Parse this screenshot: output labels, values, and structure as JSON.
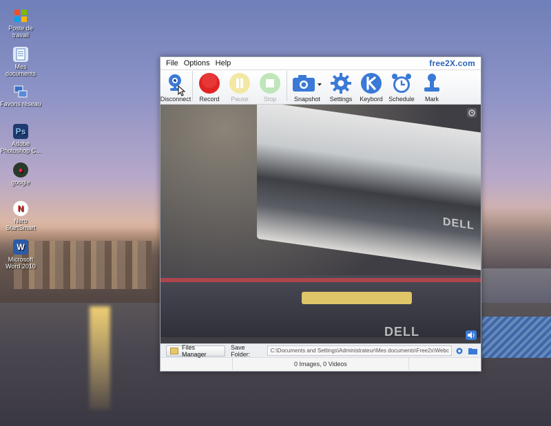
{
  "desktop": {
    "icons": [
      {
        "label": "Poste de travail",
        "glyph": "windows-logo",
        "color": "#2f8fe0"
      },
      {
        "label": "Mes documents",
        "glyph": "folder-doc",
        "color": "#6aa0d8"
      },
      {
        "label": "Favoris réseau",
        "glyph": "network",
        "color": "#3b6fc2"
      },
      {
        "label": "Adobe Photoshop C...",
        "glyph": "Ps",
        "color": "#1e3a6e"
      },
      {
        "label": "google",
        "glyph": "g",
        "color": "#2a6b2a"
      },
      {
        "label": "Nero StartSmart",
        "glyph": "N",
        "color": "#c42a2a"
      },
      {
        "label": "Microsoft Word 2010",
        "glyph": "W",
        "color": "#2b5aa8"
      }
    ]
  },
  "app": {
    "menu": [
      "File",
      "Options",
      "Help"
    ],
    "brand": "free2X.com",
    "toolbar": {
      "disconnect": "Disconnect",
      "record": "Record",
      "pause": "Pause",
      "stop": "Stop",
      "snapshot": "Snapshot",
      "settings": "Settings",
      "keyboard": "Keybord",
      "schedule": "Schedule",
      "mark": "Mark"
    },
    "video": {
      "watermark": "DELL"
    },
    "footer": {
      "files_manager": "Files Manager",
      "save_folder_label": "Save Folder:",
      "save_folder_value": "C:\\Documents and Settings\\Administrateur\\Mes documents\\Free2x\\Webcam"
    },
    "status": "0 Images, 0 Videos"
  },
  "colors": {
    "record": "#e02424",
    "accent": "#2f6fd0",
    "pause_disabled": "#f3e8a3",
    "stop_disabled": "#bfe6b8"
  }
}
